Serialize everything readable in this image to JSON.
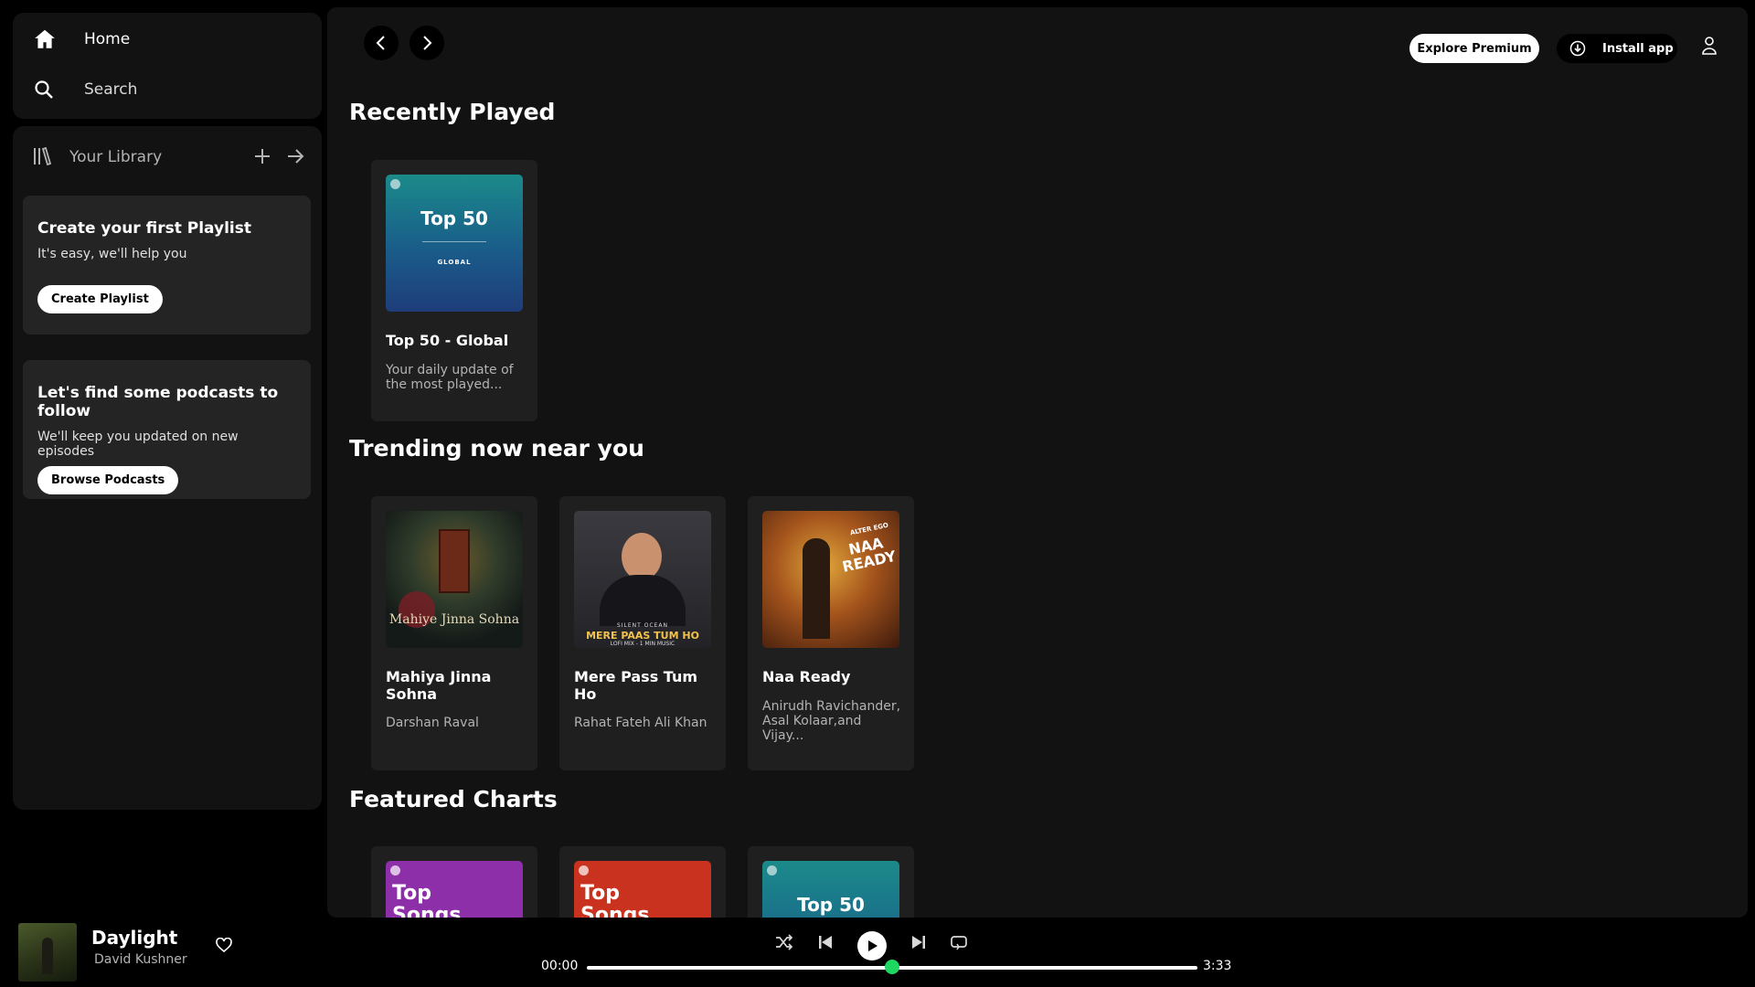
{
  "nav": {
    "home_label": "Home",
    "search_label": "Search"
  },
  "library": {
    "label": "Your Library",
    "playlist_promo": {
      "title": "Create your first Playlist",
      "text": "It's easy, we'll help you",
      "button": "Create Playlist"
    },
    "podcast_promo": {
      "title": "Let's find some podcasts to follow",
      "text": "We'll keep you updated on new episodes",
      "button": "Browse Podcasts"
    }
  },
  "header": {
    "explore_premium": "Explore Premium",
    "install_app": "Install app"
  },
  "sections": {
    "recently_played": {
      "title": "Recently Played",
      "cards": [
        {
          "title": "Top 50 - Global",
          "subtitle": "Your daily update of the most played...",
          "art_title": "Top 50",
          "art_sub": "GLOBAL"
        }
      ]
    },
    "trending": {
      "title": "Trending now near you",
      "cards": [
        {
          "title": "Mahiya Jinna Sohna",
          "subtitle": "Darshan Raval",
          "art_title": "Mahiye Jinna Sohna"
        },
        {
          "title": "Mere Pass Tum Ho",
          "subtitle": "Rahat Fateh Ali Khan",
          "art_title": "MERE PAAS TUM HO",
          "art_sub": "LOFI MIX - 1 MIN MUSIC",
          "art_small": "SILENT OCEAN"
        },
        {
          "title": "Naa Ready",
          "subtitle": "Anirudh Ravichander, Asal Kolaar,and Vijay...",
          "art_title": "NAA READY",
          "art_small": "ALTER EGO"
        }
      ]
    },
    "featured": {
      "title": "Featured Charts",
      "cards": [
        {
          "art_title": "Top Songs"
        },
        {
          "art_title": "Top Songs"
        },
        {
          "art_title": "Top 50"
        }
      ]
    }
  },
  "player": {
    "track": "Daylight",
    "artist": "David Kushner",
    "elapsed": "00:00",
    "duration": "3:33",
    "progress_fraction": 0.5
  },
  "colors": {
    "accent": "#1ed760",
    "surface": "#121212",
    "card": "#1f1f1f"
  }
}
